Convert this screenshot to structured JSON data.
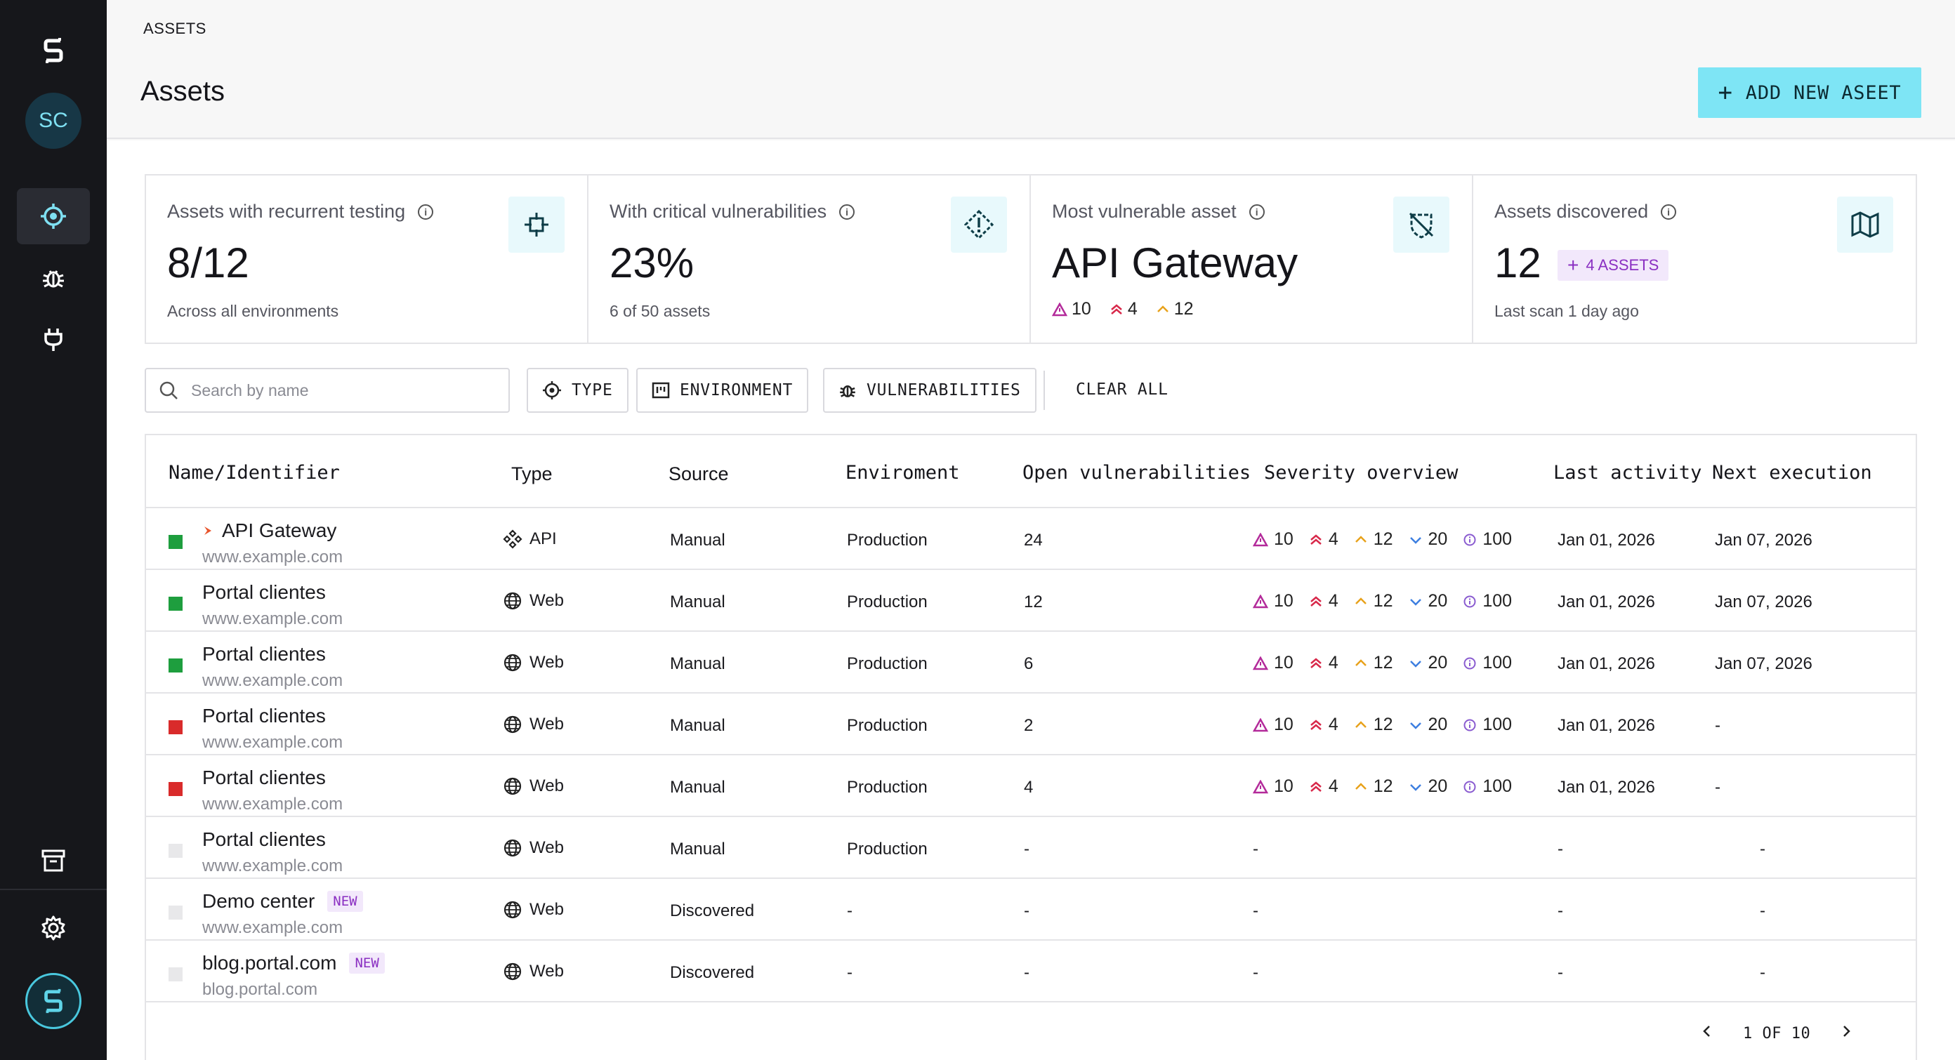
{
  "header": {
    "breadcrumb": "ASSETS",
    "title": "Assets",
    "add_button_label": "ADD NEW ASEET"
  },
  "sidebar": {
    "avatar_initials": "SC",
    "items": [
      {
        "icon": "target-icon",
        "active": true
      },
      {
        "icon": "bug-icon",
        "active": false
      },
      {
        "icon": "plug-icon",
        "active": false
      },
      {
        "icon": "archive-icon",
        "active": false
      },
      {
        "icon": "gear-icon",
        "active": false
      }
    ]
  },
  "cards": [
    {
      "label": "Assets with recurrent testing",
      "value": "8/12",
      "sub": "Across all environments",
      "icon": "crosshair-icon"
    },
    {
      "label": "With critical vulnerabilities",
      "value": "23%",
      "sub": "6 of 50 assets",
      "icon": "diamond-alert-icon"
    },
    {
      "label": "Most vulnerable asset",
      "value": "API Gateway",
      "severity": {
        "critical": "10",
        "high": "4",
        "medium": "12"
      },
      "icon": "shield-off-icon"
    },
    {
      "label": "Assets discovered",
      "value": "12",
      "badge": "4 ASSETS",
      "sub": "Last scan 1 day ago",
      "icon": "map-icon"
    }
  ],
  "filters": {
    "search_placeholder": "Search by name",
    "type_label": "TYPE",
    "environment_label": "ENVIRONMENT",
    "vulnerabilities_label": "VULNERABILITIES",
    "clear_all_label": "CLEAR ALL"
  },
  "table": {
    "columns": [
      "Name/Identifier",
      "Type",
      "Source",
      "Enviroment",
      "Open vulnerabilities",
      "Severity overview",
      "Last activity",
      "Next execution"
    ],
    "new_badge": "NEW",
    "rows": [
      {
        "status": "#1e9e3e",
        "name": "API Gateway",
        "flag": true,
        "identifier": "www.example.com",
        "type": "API",
        "type_icon": "api-icon",
        "source": "Manual",
        "environment": "Production",
        "open_vulns": "24",
        "severity": {
          "critical": "10",
          "high": "4",
          "medium": "12",
          "low": "20",
          "info": "100"
        },
        "last_activity": "Jan 01, 2026",
        "next_execution": "Jan 07, 2026",
        "is_new": false
      },
      {
        "status": "#1e9e3e",
        "name": "Portal clientes",
        "identifier": "www.example.com",
        "type": "Web",
        "type_icon": "globe-icon",
        "source": "Manual",
        "environment": "Production",
        "open_vulns": "12",
        "severity": {
          "critical": "10",
          "high": "4",
          "medium": "12",
          "low": "20",
          "info": "100"
        },
        "last_activity": "Jan 01, 2026",
        "next_execution": "Jan 07, 2026",
        "is_new": false
      },
      {
        "status": "#1e9e3e",
        "name": "Portal clientes",
        "identifier": "www.example.com",
        "type": "Web",
        "type_icon": "globe-icon",
        "source": "Manual",
        "environment": "Production",
        "open_vulns": "6",
        "severity": {
          "critical": "10",
          "high": "4",
          "medium": "12",
          "low": "20",
          "info": "100"
        },
        "last_activity": "Jan 01, 2026",
        "next_execution": "Jan 07, 2026",
        "is_new": false
      },
      {
        "status": "#d92b2b",
        "name": "Portal clientes",
        "identifier": "www.example.com",
        "type": "Web",
        "type_icon": "globe-icon",
        "source": "Manual",
        "environment": "Production",
        "open_vulns": "2",
        "severity": {
          "critical": "10",
          "high": "4",
          "medium": "12",
          "low": "20",
          "info": "100"
        },
        "last_activity": "Jan 01, 2026",
        "next_execution": "-",
        "is_new": false
      },
      {
        "status": "#d92b2b",
        "name": "Portal clientes",
        "identifier": "www.example.com",
        "type": "Web",
        "type_icon": "globe-icon",
        "source": "Manual",
        "environment": "Production",
        "open_vulns": "4",
        "severity": {
          "critical": "10",
          "high": "4",
          "medium": "12",
          "low": "20",
          "info": "100"
        },
        "last_activity": "Jan 01, 2026",
        "next_execution": "-",
        "is_new": false
      },
      {
        "status": "#e8e8ea",
        "name": "Portal clientes",
        "identifier": "www.example.com",
        "type": "Web",
        "type_icon": "globe-icon",
        "source": "Manual",
        "environment": "Production",
        "open_vulns": "-",
        "severity_text": "-",
        "last_activity": "-",
        "next_execution": "-",
        "is_new": false
      },
      {
        "status": "#e8e8ea",
        "name": "Demo center",
        "identifier": "www.example.com",
        "type": "Web",
        "type_icon": "globe-icon",
        "source": "Discovered",
        "environment": "-",
        "open_vulns": "-",
        "severity_text": "-",
        "last_activity": "-",
        "next_execution": "-",
        "is_new": true
      },
      {
        "status": "#e8e8ea",
        "name": "blog.portal.com",
        "identifier": "blog.portal.com",
        "type": "Web",
        "type_icon": "globe-icon",
        "source": "Discovered",
        "environment": "-",
        "open_vulns": "-",
        "severity_text": "-",
        "last_activity": "-",
        "next_execution": "-",
        "is_new": true
      }
    ]
  },
  "pagination": {
    "label": "1 OF 10"
  },
  "colors": {
    "accent": "#7ee5f5",
    "critical": "#b32a9a",
    "high": "#d8284a",
    "medium": "#e8a21b",
    "low": "#3d7fe0",
    "info": "#8a5cd0"
  }
}
